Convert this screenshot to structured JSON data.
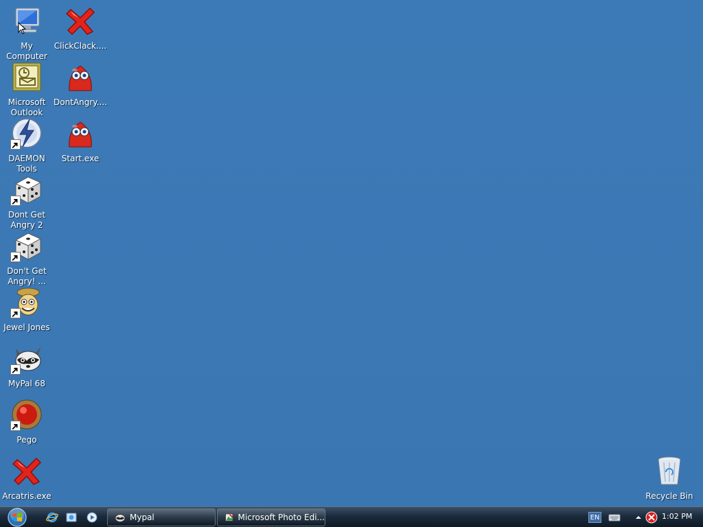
{
  "desktop": {
    "background_color": "#3b78b4",
    "icons": [
      {
        "name": "my-computer-icon",
        "label": "My Computer",
        "kind": "computer"
      },
      {
        "name": "clickclack-icon",
        "label": "ClickClack....",
        "kind": "red-x"
      },
      {
        "name": "microsoft-outlook-icon",
        "label": "Microsoft\nOutlook",
        "kind": "outlook"
      },
      {
        "name": "dontangry-icon",
        "label": "DontAngry....",
        "kind": "red-blob"
      },
      {
        "name": "daemon-tools-icon",
        "label": "DAEMON\nTools",
        "kind": "daemon",
        "shortcut": true
      },
      {
        "name": "start-exe-icon",
        "label": "Start.exe",
        "kind": "red-blob"
      },
      {
        "name": "dont-get-angry-2-icon",
        "label": "Dont Get\nAngry 2",
        "kind": "dice",
        "shortcut": true
      },
      {
        "name": "dont-get-angry-icon",
        "label": "Don't Get\nAngry! ...",
        "kind": "dice",
        "shortcut": true
      },
      {
        "name": "jewel-jones-icon",
        "label": "Jewel Jones",
        "kind": "jewel",
        "shortcut": true
      },
      {
        "name": "mypal-68-icon",
        "label": "MyPal 68",
        "kind": "raccoon",
        "shortcut": true
      },
      {
        "name": "pego-icon",
        "label": "Pego",
        "kind": "red-ball",
        "shortcut": true
      },
      {
        "name": "arcatris-icon",
        "label": "Arcatris.exe",
        "kind": "red-x"
      },
      {
        "name": "recycle-bin-icon",
        "label": "Recycle Bin",
        "kind": "recycle"
      }
    ]
  },
  "taskbar": {
    "quick_launch": [
      {
        "name": "internet-explorer-icon"
      },
      {
        "name": "show-desktop-icon"
      },
      {
        "name": "media-player-icon"
      }
    ],
    "tasks": [
      {
        "label": "Mypal",
        "icon": "mypal-task-icon"
      },
      {
        "label": "Microsoft Photo Edi...",
        "icon": "photo-editor-task-icon"
      }
    ],
    "tray": {
      "language": "EN",
      "clock": "1:02 PM"
    }
  }
}
